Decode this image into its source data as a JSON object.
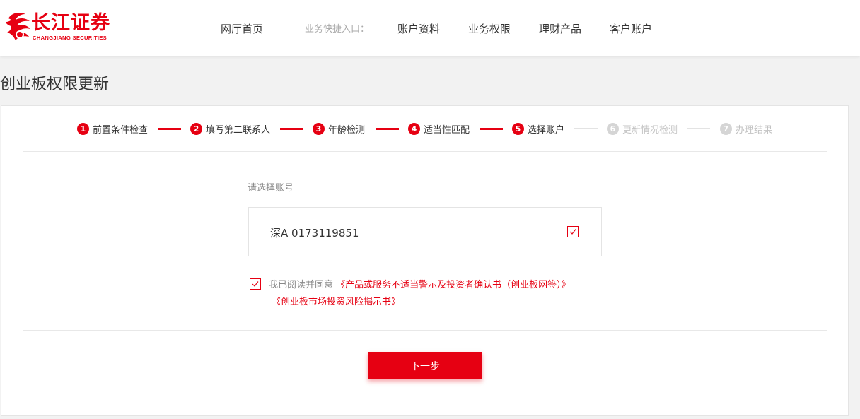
{
  "brand": {
    "name_cn": "长江证券",
    "name_en": "CHANGJIANG SECURITIES",
    "color": "#e60012",
    "logo_icon": "phoenix-logo-icon"
  },
  "nav": {
    "home": "网厅首页",
    "quick_entry_label": "业务快捷入口：",
    "items": [
      "账户资料",
      "业务权限",
      "理财产品",
      "客户账户"
    ]
  },
  "page": {
    "title": "创业板权限更新"
  },
  "steps": [
    {
      "num": "1",
      "label": "前置条件检查",
      "done": true
    },
    {
      "num": "2",
      "label": "填写第二联系人",
      "done": true
    },
    {
      "num": "3",
      "label": "年龄检测",
      "done": true
    },
    {
      "num": "4",
      "label": "适当性匹配",
      "done": true
    },
    {
      "num": "5",
      "label": "选择账户",
      "done": true
    },
    {
      "num": "6",
      "label": "更新情况检测",
      "done": false
    },
    {
      "num": "7",
      "label": "办理结果",
      "done": false
    }
  ],
  "account_select": {
    "label": "请选择账号",
    "account": "深A 0173119851",
    "checked": true
  },
  "agreement": {
    "prefix": "我已阅读并同意",
    "doc1": "《产品或服务不适当警示及投资者确认书（创业板网签）》",
    "doc2": "《创业板市场投资风险揭示书》",
    "checked": true
  },
  "actions": {
    "next": "下一步"
  }
}
